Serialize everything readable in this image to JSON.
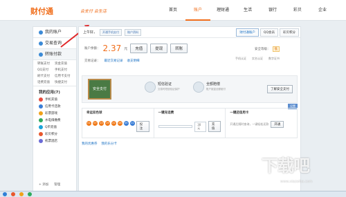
{
  "header": {
    "logo": "财付通",
    "slogan": "会支付 会生活",
    "nav": [
      "首页",
      "账户",
      "理财通",
      "生活",
      "银行",
      "彩贝",
      "企业"
    ],
    "active_nav": "账户"
  },
  "sidebar": {
    "my_account": "我的账户",
    "trade_query": "交易查询",
    "shortcut_pay": "转账付款",
    "sub_items": [
      "转账支付",
      "资金充值",
      "QQ支付",
      "手机支付",
      "刷卡支付",
      "信用卡支付",
      "话费充值",
      "快捷支付"
    ],
    "apps_title": "我的应用",
    "apps_count": "(7)",
    "apps": [
      {
        "label": "手机充值",
        "color": "#e84c3d"
      },
      {
        "label": "信用卡还款",
        "color": "#3a7ed6"
      },
      {
        "label": "彩票游戏",
        "color": "#f0a21a"
      },
      {
        "label": "水电煤缴费",
        "color": "#2eaa5c"
      },
      {
        "label": "Q币充值",
        "color": "#1aa3d9"
      },
      {
        "label": "彩贝积分",
        "color": "#e8572c"
      },
      {
        "label": "机票酒店",
        "color": "#6a6ad6"
      }
    ],
    "add": "+ 添加",
    "manage": "管理"
  },
  "account": {
    "greeting": "上午好，",
    "btn_phone": "开通手机支付",
    "btn_info": "账户资料",
    "tabs": [
      "财付通账户",
      "QQ会员",
      "彩贝积分"
    ],
    "balance_label": "账户余额：",
    "balance": "2.37",
    "unit": "元",
    "actions": [
      "充值",
      "提现",
      "转账"
    ],
    "safety_label": "安全等级：",
    "safety_value": "低",
    "verify": [
      "手机认证",
      "实名认证",
      "数字证书"
    ],
    "record_label": "交易记录：",
    "record_link": "最近交易记录",
    "record_link2": "收支明细"
  },
  "banner": {
    "board_text": "安全支付",
    "feature1_title": "短信验证",
    "feature1_desc": "交易时短信验证保护",
    "feature2_title": "全额赔偿",
    "feature2_desc": "账户被盗全额赔付",
    "learn": "了解安全支付"
  },
  "panels": {
    "setup_btn": "设置",
    "lottery_title": "幸运双色球",
    "balls": [
      "01",
      "07",
      "13",
      "19",
      "22",
      "28",
      "05",
      "11"
    ],
    "lottery_btn": "投注",
    "phone_title": "一键充话费",
    "phone_amount": "30元",
    "phone_btn": "充值",
    "card_title": "一键还信用卡",
    "card_desc": "开通后随时查询，一键轻松还款",
    "card_btn": "开通"
  },
  "links": [
    "我的优惠券",
    "我的乐分卡"
  ],
  "watermark": "下载吧",
  "watermark_url": "www.xiazaiba.com"
}
